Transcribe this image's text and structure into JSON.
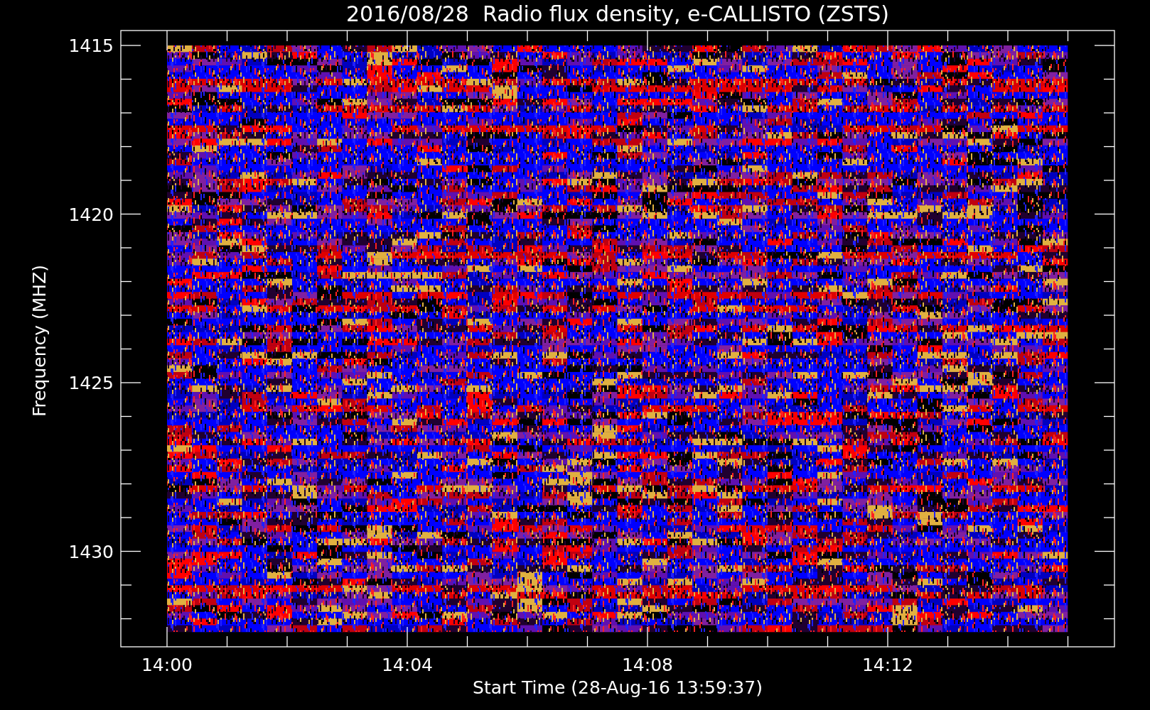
{
  "title": "2016/08/28  Radio flux density, e-CALLISTO (ZSTS)",
  "y_axis": {
    "label": "Frequency (MHZ)",
    "ticks": [
      "1415",
      "1420",
      "1425",
      "1430"
    ]
  },
  "x_axis": {
    "label": "Start Time (28-Aug-16 13:59:37)",
    "ticks": [
      "14:00",
      "14:04",
      "14:08",
      "14:12"
    ]
  }
}
